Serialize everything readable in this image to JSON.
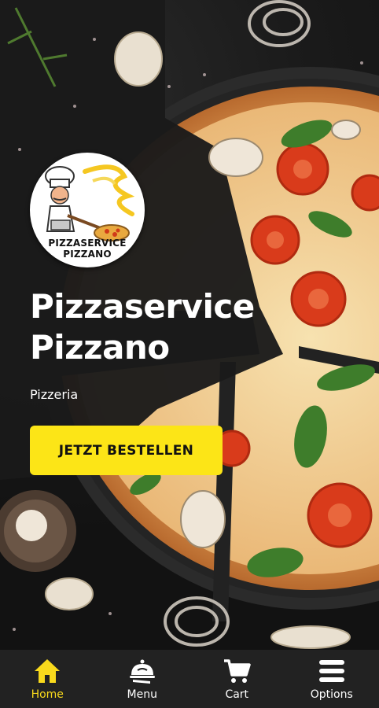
{
  "hero": {
    "logo": {
      "line1": "PIZZASERVICE",
      "line2": "PIZZANO"
    },
    "title_line1": "Pizzaservice",
    "title_line2": "Pizzano",
    "subtitle": "Pizzeria",
    "cta_label": "JETZT BESTELLEN"
  },
  "nav": {
    "items": [
      {
        "label": "Home",
        "icon": "home-icon",
        "active": true
      },
      {
        "label": "Menu",
        "icon": "cloche-icon",
        "active": false
      },
      {
        "label": "Cart",
        "icon": "cart-icon",
        "active": false
      },
      {
        "label": "Options",
        "icon": "menu-bars-icon",
        "active": false
      }
    ]
  },
  "colors": {
    "accent": "#fce517",
    "nav_active": "#f8d91c",
    "nav_bg": "#222222",
    "background": "#141414"
  }
}
